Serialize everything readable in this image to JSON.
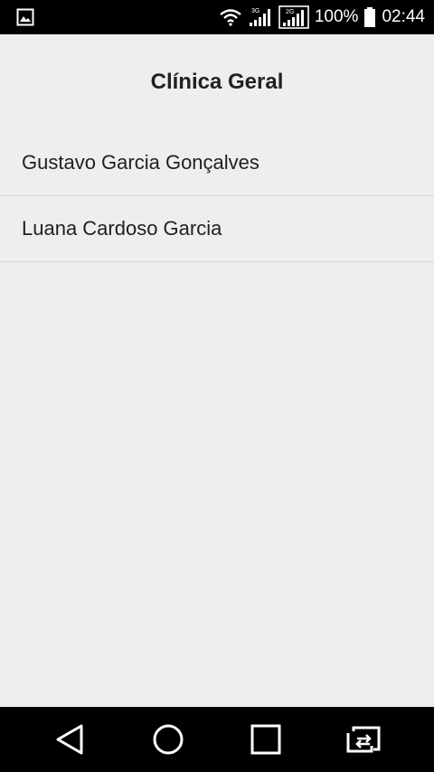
{
  "status_bar": {
    "battery_percent": "100%",
    "time": "02:44",
    "network_label_1": "3G",
    "network_label_2": "2G",
    "icons": [
      "image-notification-icon",
      "wifi-icon",
      "signal-3g-icon",
      "signal-2g-icon",
      "battery-icon"
    ]
  },
  "header": {
    "title": "Clínica Geral"
  },
  "list": {
    "items": [
      {
        "label": "Gustavo Garcia Gonçalves"
      },
      {
        "label": "Luana Cardoso Garcia"
      }
    ]
  },
  "nav_bar": {
    "icons": [
      "back-icon",
      "home-icon",
      "recents-icon",
      "switch-icon"
    ]
  },
  "colors": {
    "background": "#eeeeee",
    "bars": "#000000",
    "text": "#212121",
    "divider": "#d4d4d4"
  }
}
